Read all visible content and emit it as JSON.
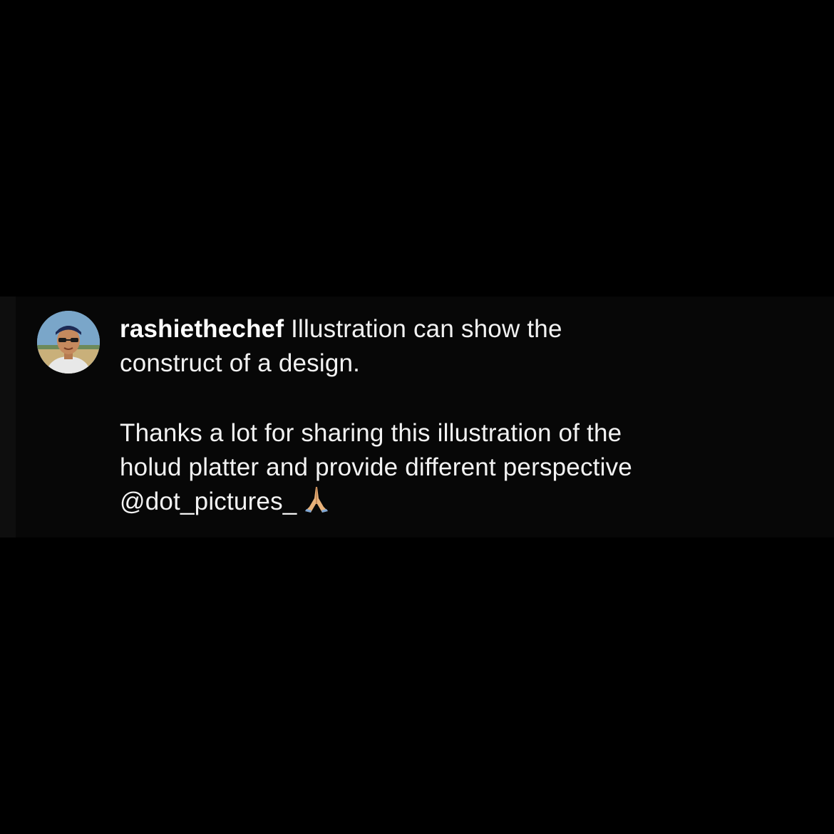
{
  "comment": {
    "username": "rashiethechef",
    "line1": "Illustration can show the",
    "line2": "construct of a design.",
    "line3": "Thanks a lot for sharing this illustration of the",
    "line4": "holud platter and provide different perspective",
    "mention": "@dot_pictures_",
    "emoji": "folded-hands-emoji"
  },
  "avatar": {
    "icon": "profile-photo",
    "colors": {
      "sky": "#7aa6c9",
      "cap": "#1c2a55",
      "skin": "#c58a5e",
      "shirt": "#e8e8e8",
      "ground": "#c9b07a"
    }
  },
  "colors": {
    "background": "#000000",
    "text": "#f2f2f2"
  }
}
